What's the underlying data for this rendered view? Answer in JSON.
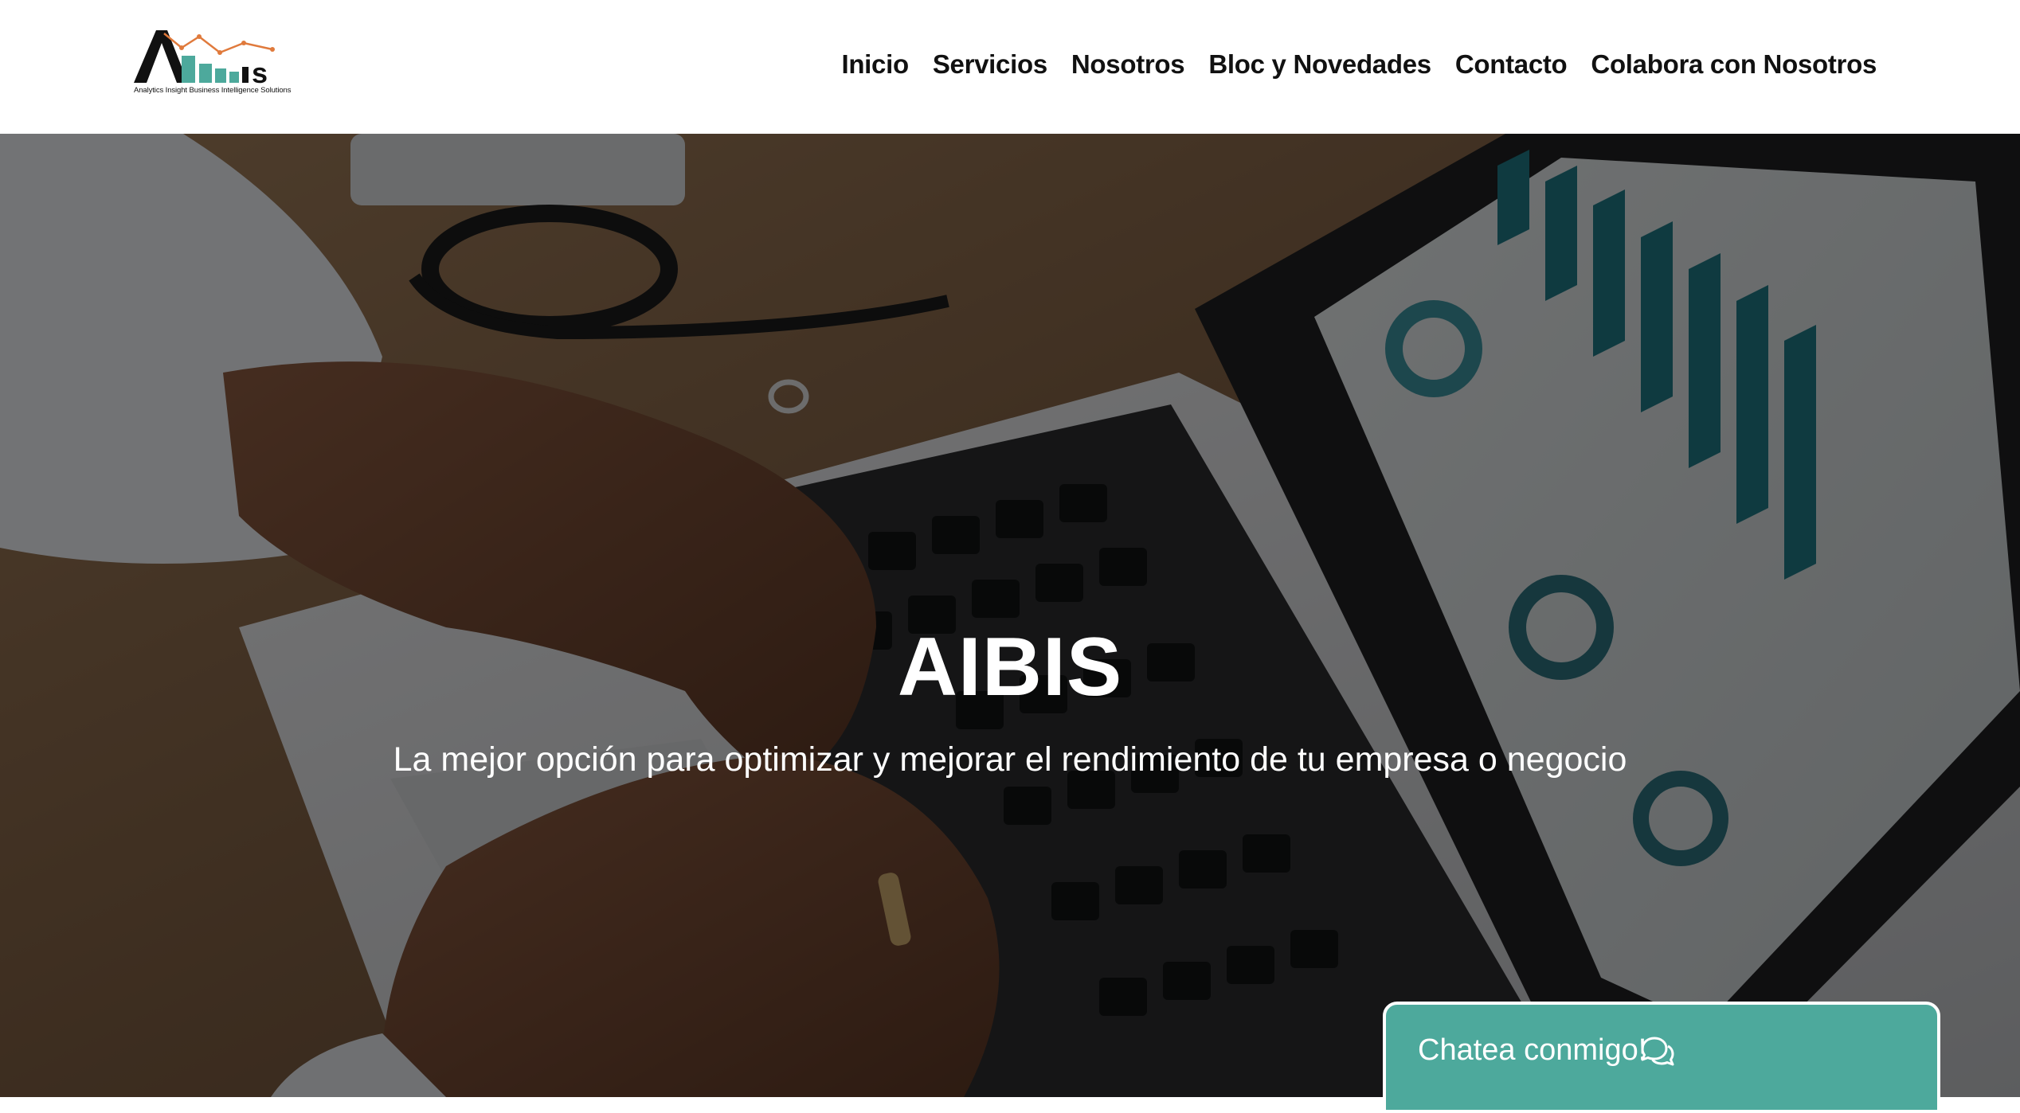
{
  "brand": {
    "logo_name": "AIBIS",
    "logo_tagline": "Analytics Insight Business Intelligence Solutions",
    "accent_color": "#4da99c",
    "logo_trend_color": "#e07a3c"
  },
  "nav": {
    "items": [
      {
        "label": "Inicio"
      },
      {
        "label": "Servicios"
      },
      {
        "label": "Nosotros"
      },
      {
        "label": "Bloc y Novedades"
      },
      {
        "label": "Contacto"
      },
      {
        "label": "Colabora con Nosotros"
      }
    ]
  },
  "hero": {
    "title": "AIBIS",
    "subtitle": "La mejor opción para optimizar y mejorar el rendimiento de tu empresa o negocio",
    "background_icon": "laptop-analytics-photo"
  },
  "chat": {
    "label": "Chatea conmigo!",
    "icon": "chat-bubbles-icon"
  }
}
